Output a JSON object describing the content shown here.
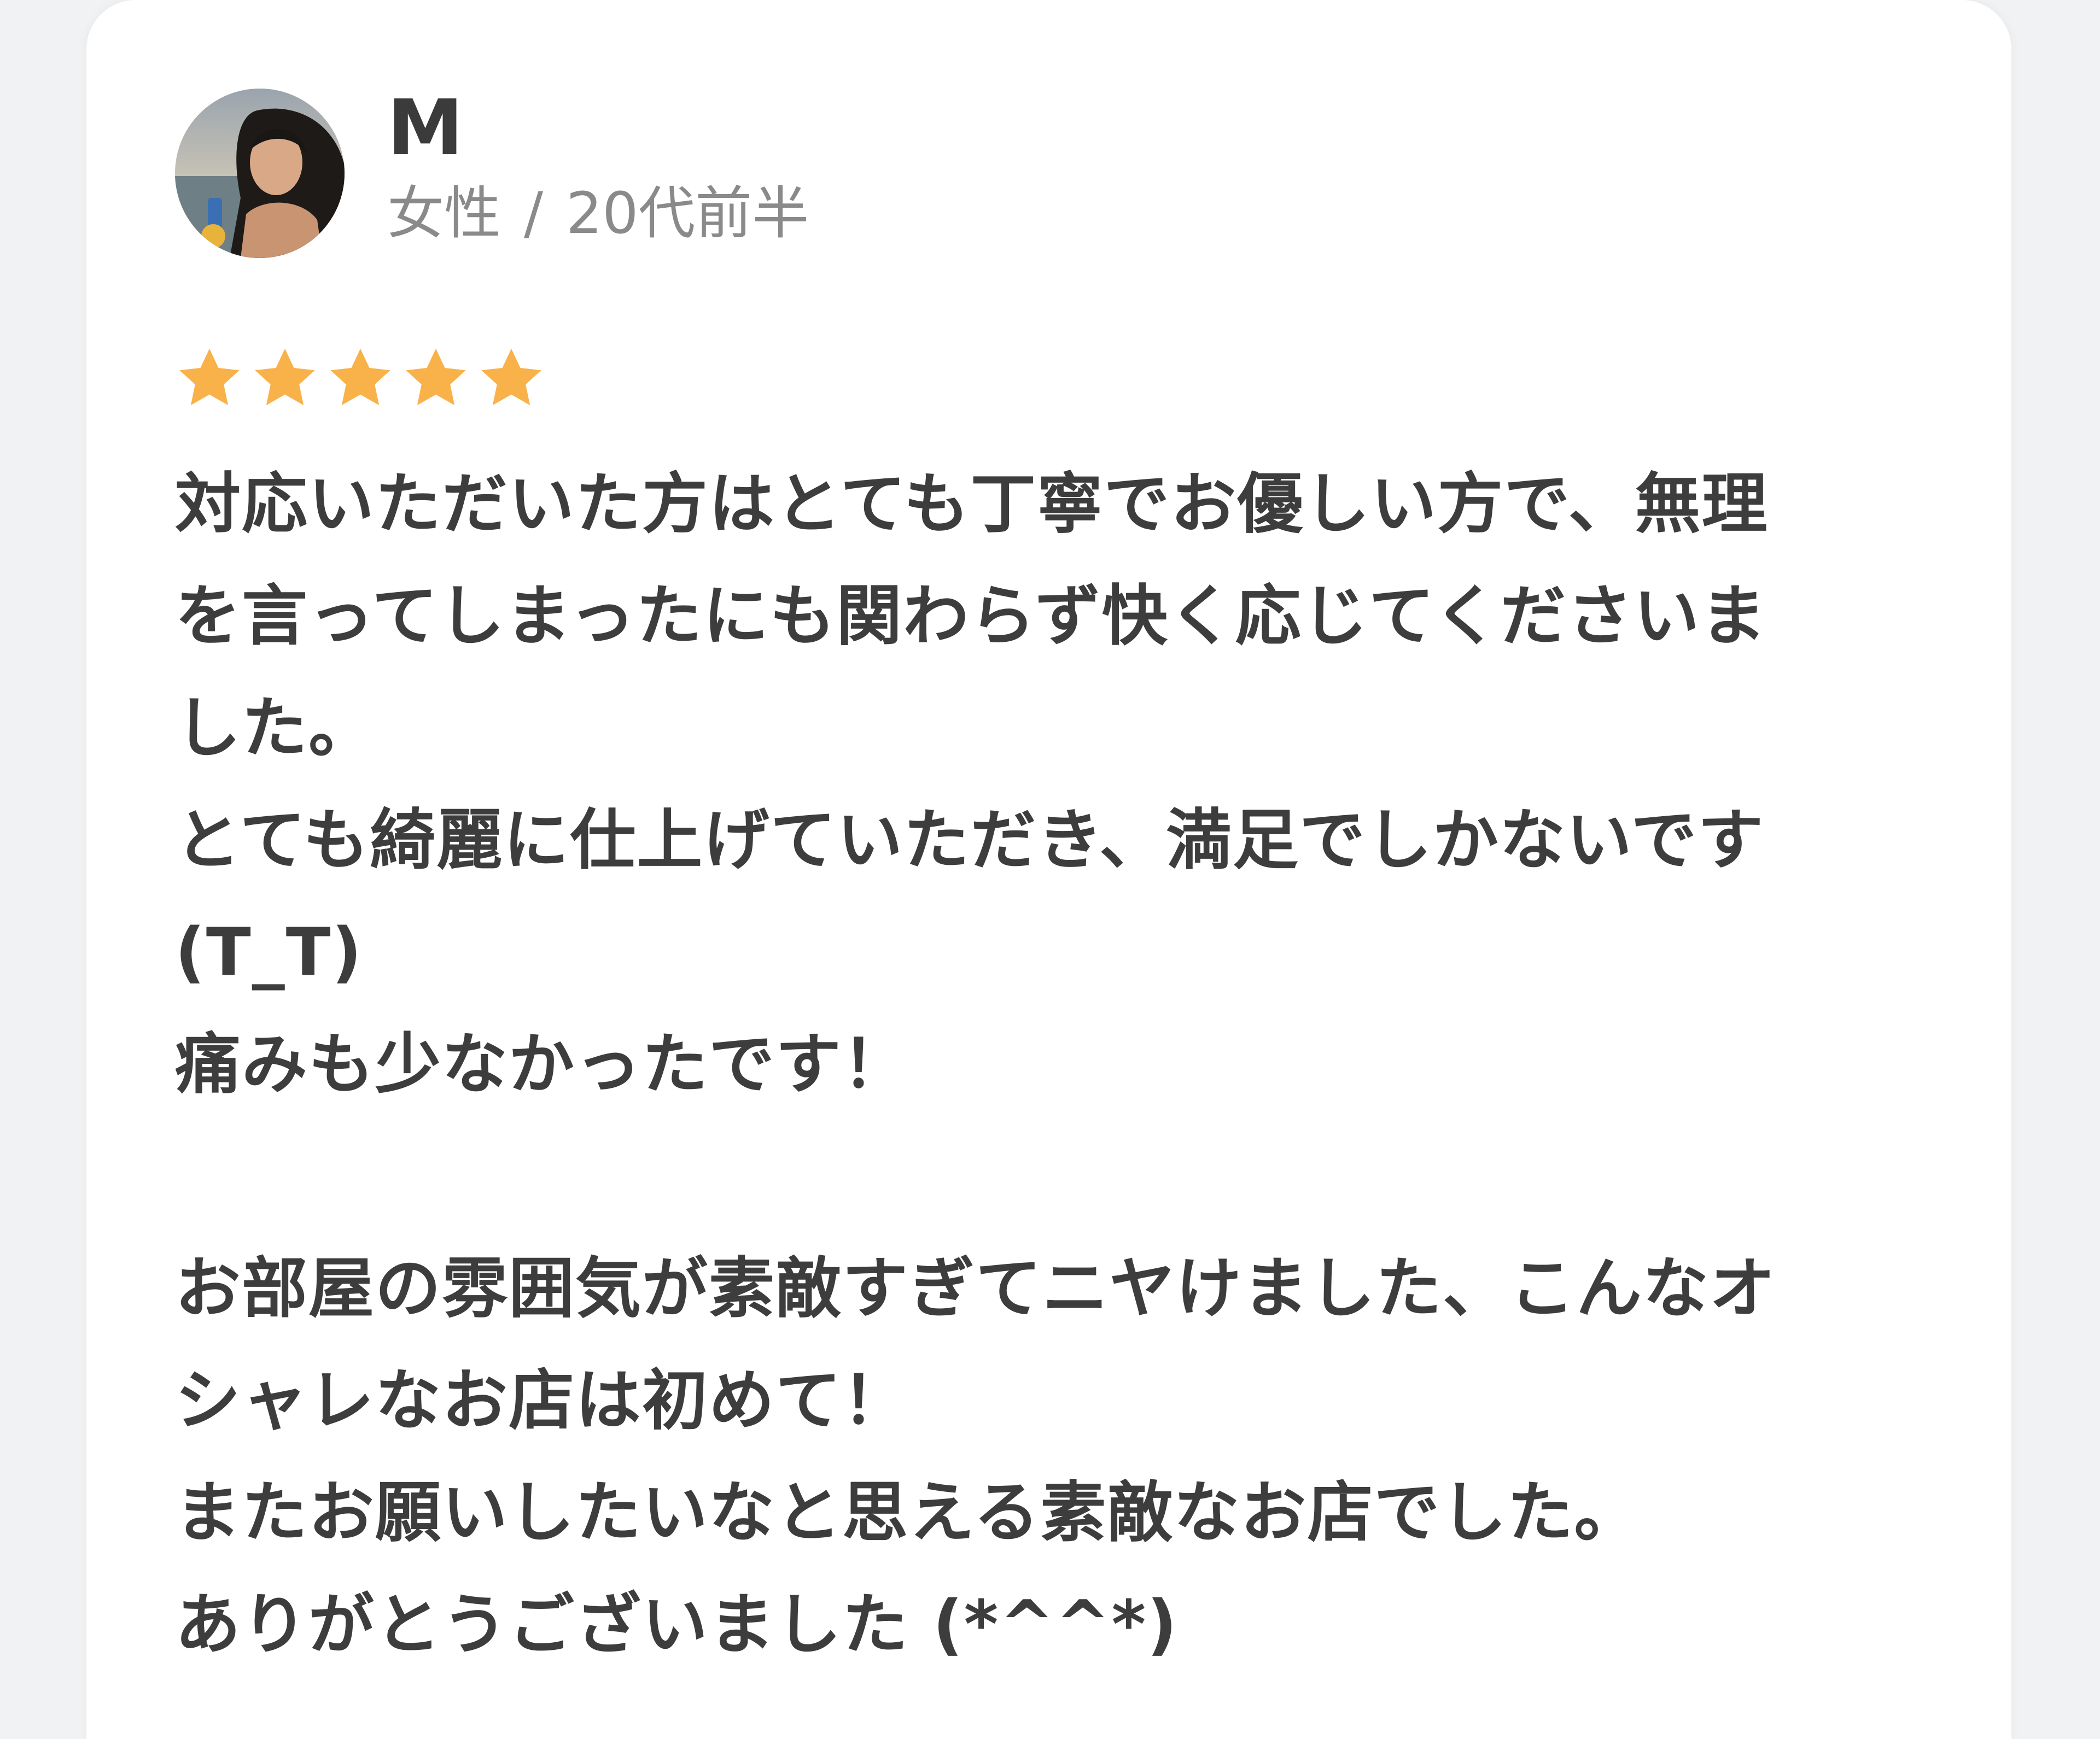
{
  "reviewer": {
    "name": "M",
    "gender": "女性",
    "separator": "/",
    "age_group": "20代前半"
  },
  "rating": {
    "stars_filled": 5,
    "stars_total": 5,
    "star_color": "#f9b24a"
  },
  "review": {
    "lines": [
      "対応いただいた方はとても丁寧でお優しい方で、無理",
      "を言ってしまったにも関わらず快く応じてくださいま",
      "した。",
      "とても綺麗に仕上げていただき、満足でしかないです",
      "(T_T)",
      "痛みも少なかったです！",
      "",
      "お部屋の雰囲気が素敵すぎてニヤけました、こんなオ",
      "シャレなお店は初めて！",
      "またお願いしたいなと思える素敵なお店でした。",
      "ありがとうございました (*^^*)"
    ]
  },
  "colors": {
    "page_background": "#f1f2f4",
    "card_background": "#ffffff",
    "text_primary": "#3d3d3d",
    "text_secondary": "#8a8a8a"
  }
}
